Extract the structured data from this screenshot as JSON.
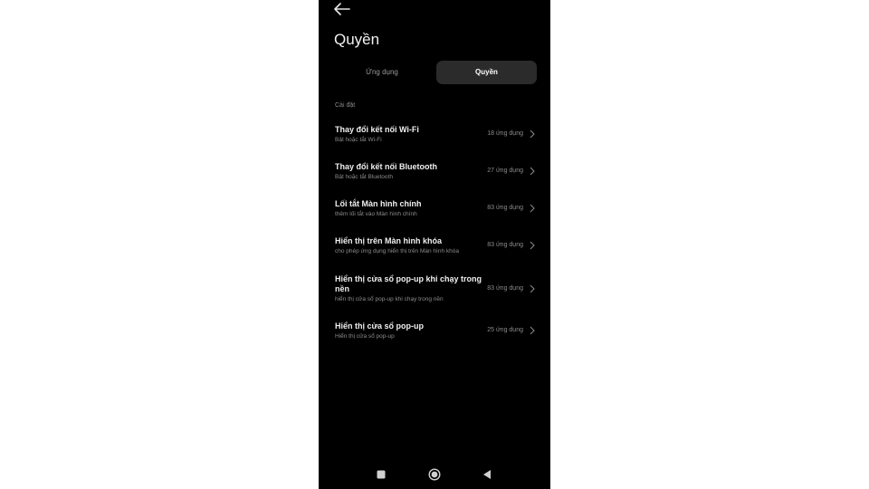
{
  "header": {
    "title": "Quyền"
  },
  "tabs": [
    {
      "label": "Ứng dụng",
      "active": false
    },
    {
      "label": "Quyền",
      "active": true
    }
  ],
  "section_label": "Cài đặt",
  "items": [
    {
      "title": "Thay đổi kết nối Wi-Fi",
      "subtitle": "Bật hoặc tắt Wi-Fi",
      "count": "18 ứng dụng"
    },
    {
      "title": "Thay đổi kết nối Bluetooth",
      "subtitle": "Bật hoặc tắt Bluetooth",
      "count": "27 ứng dụng"
    },
    {
      "title": "Lối tắt Màn hình chính",
      "subtitle": "thêm lối tắt vào Màn hình chính",
      "count": "83 ứng dụng"
    },
    {
      "title": "Hiển thị trên Màn hình khóa",
      "subtitle": "cho phép ứng dụng hiển thị trên Màn hình khóa",
      "count": "83 ứng dụng"
    },
    {
      "title": "Hiển thị cửa sổ pop-up khi chạy trong nền",
      "subtitle": "hiển thị cửa sổ pop-up khi chạy trong nền",
      "count": "83 ứng dụng"
    },
    {
      "title": "Hiển thị cửa sổ pop-up",
      "subtitle": "Hiển thị cửa sổ pop-up",
      "count": "25 ứng dụng"
    }
  ],
  "icons": {
    "back": "arrow-left-icon",
    "chevron": "chevron-right-icon",
    "nav_recents": "square-icon",
    "nav_home": "circle-icon",
    "nav_back": "triangle-left-icon"
  },
  "colors": {
    "background": "#000000",
    "active_tab": "#2b2b2b",
    "text": "#f0f0f0",
    "muted": "#8c8c8c"
  }
}
